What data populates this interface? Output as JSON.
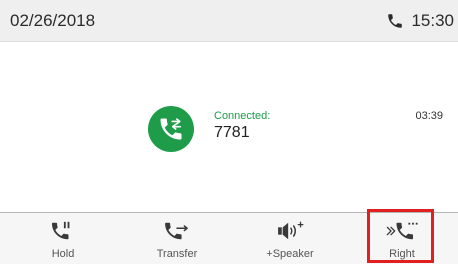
{
  "status_bar": {
    "date": "02/26/2018",
    "time": "15:30",
    "phone_icon": "phone-handset-icon"
  },
  "call": {
    "status": "Connected:",
    "number": "7781",
    "duration": "03:39",
    "avatar_icon": "call-transfer-icon",
    "accent_color": "#1e9c4a"
  },
  "softkeys": [
    {
      "label": "Hold",
      "icon": "hold-icon"
    },
    {
      "label": "Transfer",
      "icon": "transfer-icon"
    },
    {
      "label": "+Speaker",
      "icon": "speaker-icon"
    },
    {
      "label": "Right",
      "icon": "right-more-icon"
    }
  ],
  "highlight_color": "#e02020"
}
